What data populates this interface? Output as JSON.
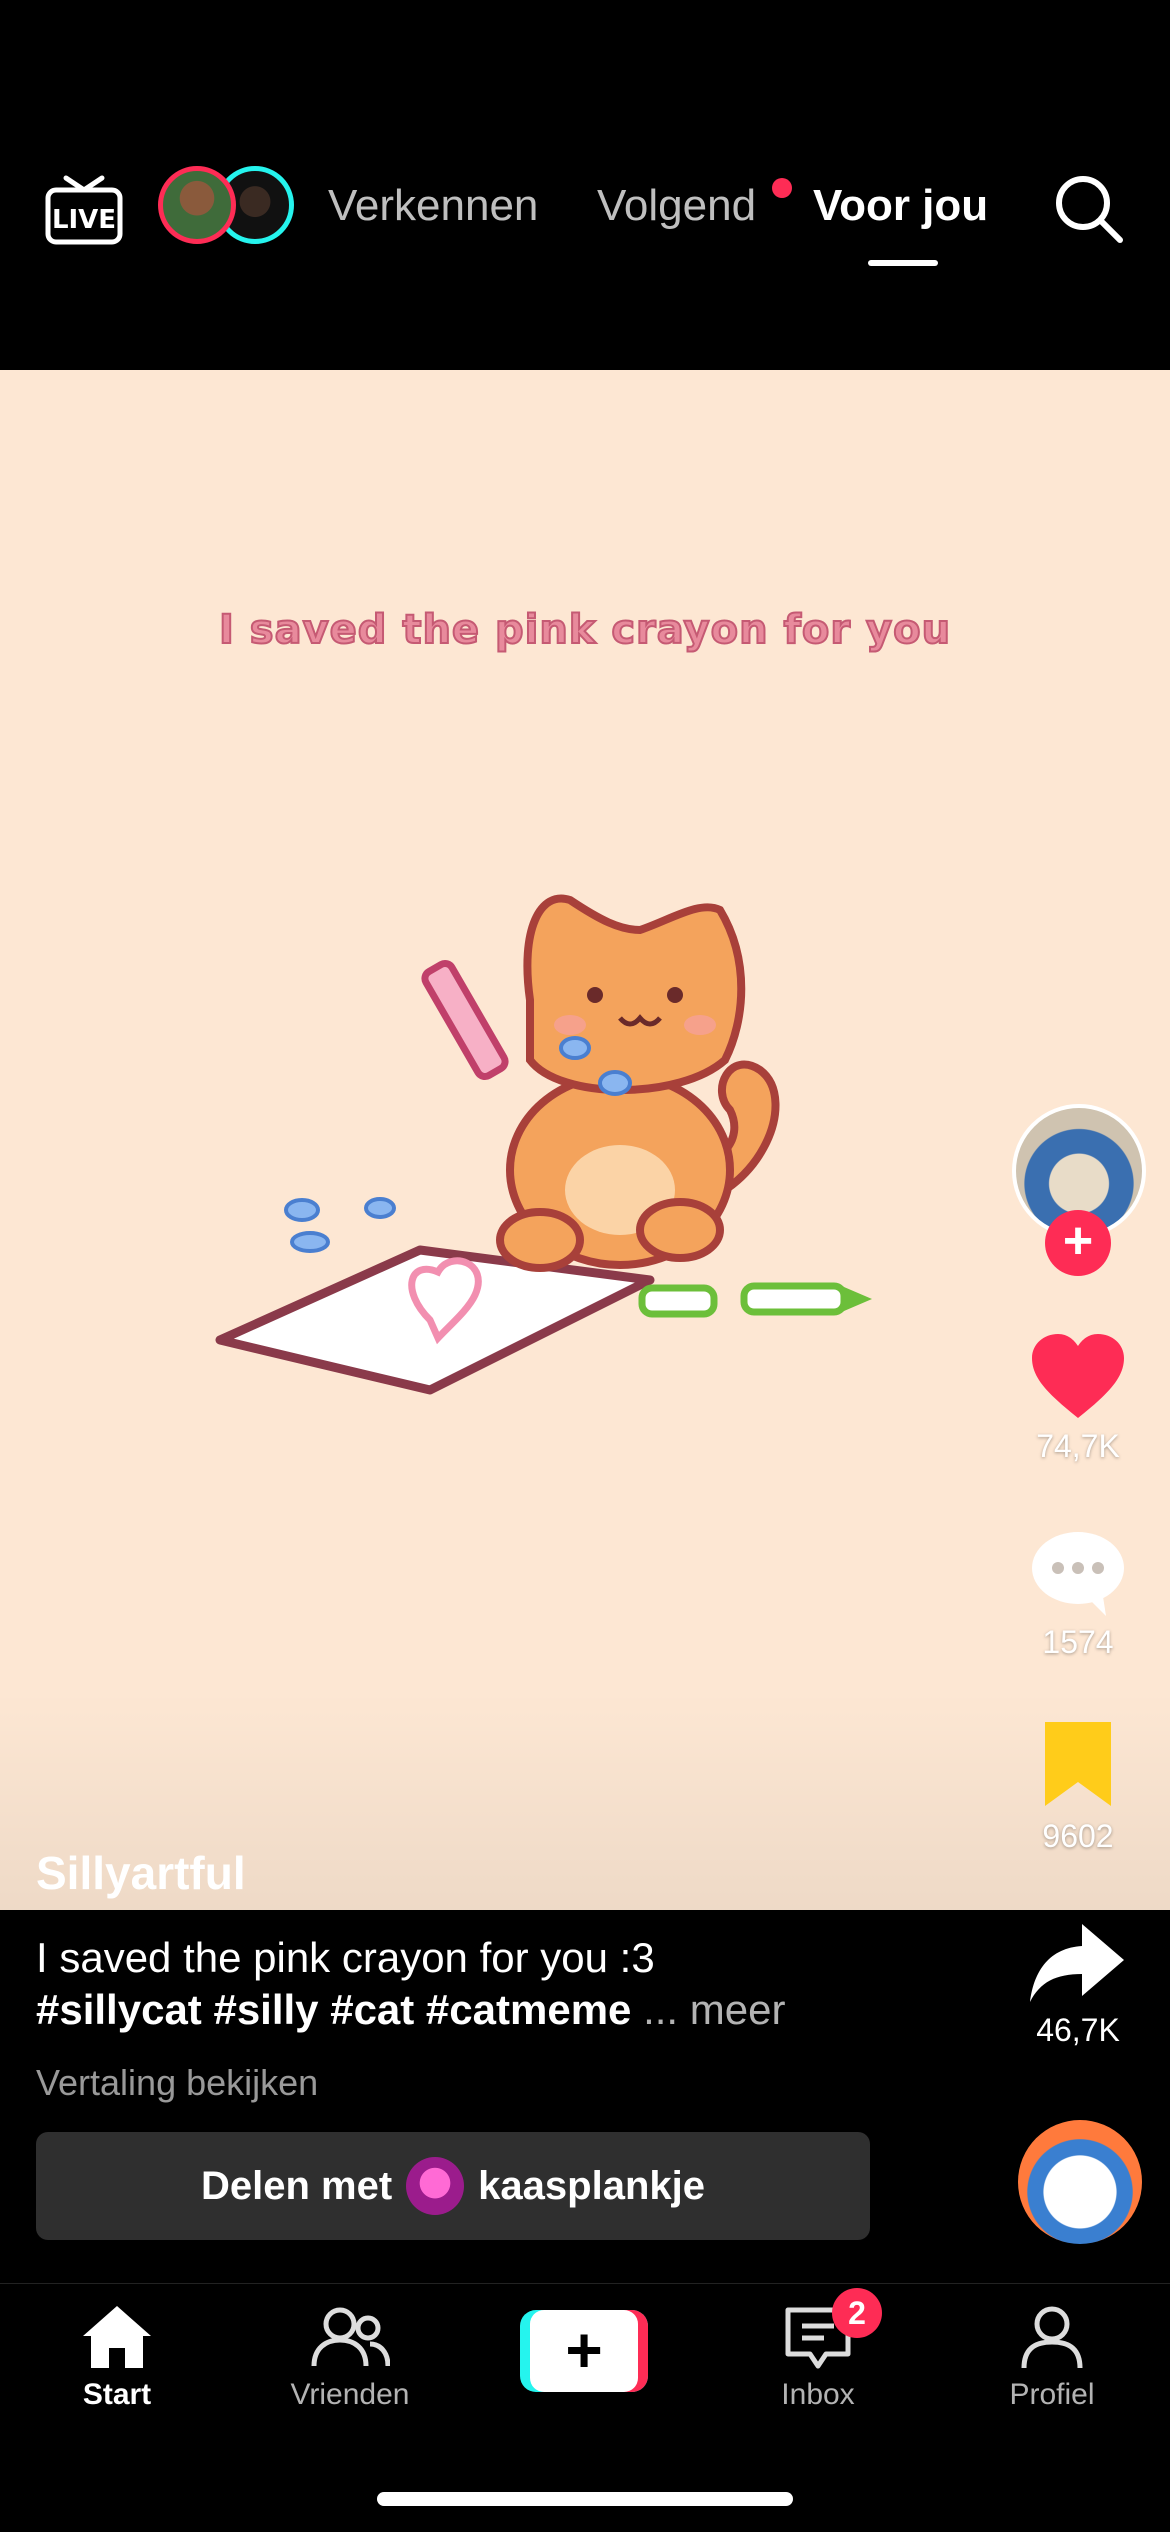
{
  "header": {
    "live_label": "LIVE",
    "tabs": [
      {
        "label": "Verkennen"
      },
      {
        "label": "Volgend"
      },
      {
        "label": "Voor jou"
      }
    ]
  },
  "video": {
    "overlay_text": "I saved the pink crayon for you"
  },
  "actions": {
    "likes": "74,7K",
    "comments": "1574",
    "bookmarks": "9602",
    "shares": "46,7K"
  },
  "post": {
    "username": "Sillyartful",
    "description": "I saved the pink crayon for you :3",
    "hashtags": "#sillycat #silly #cat #catmeme",
    "more_label": "... meer",
    "translate_label": "Vertaling bekijken",
    "share_with_label": "Delen met",
    "share_with_user": "kaasplankje"
  },
  "bottom_nav": {
    "items": [
      {
        "label": "Start"
      },
      {
        "label": "Vrienden"
      },
      {
        "label": "Inbox"
      },
      {
        "label": "Profiel"
      }
    ],
    "inbox_badge": "2",
    "create_symbol": "+"
  },
  "colors": {
    "accent_red": "#fe2c55",
    "accent_cyan": "#25f4ee",
    "bookmark_yellow": "#ffcc1a",
    "video_background": "#fde7d3"
  }
}
